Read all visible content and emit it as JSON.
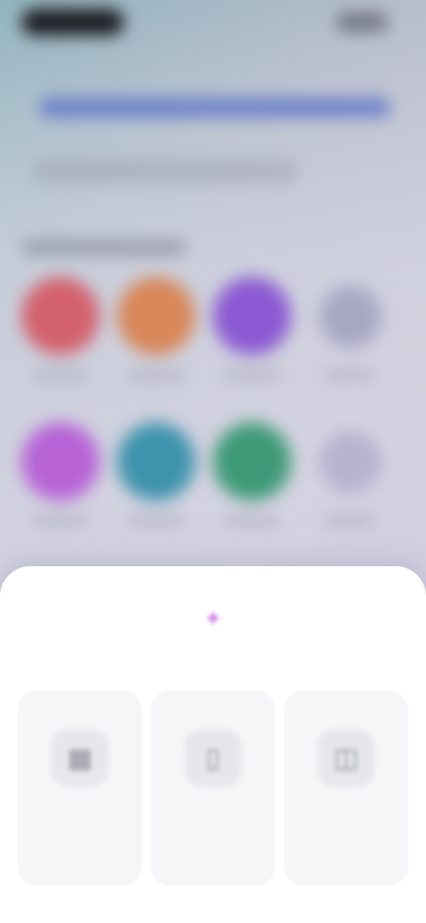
{
  "background": {
    "circles_row1": [
      {
        "color": "#d3616e"
      },
      {
        "color": "#d8875a"
      },
      {
        "color": "#8c5ad2"
      },
      {
        "color": "#a7a7c4"
      }
    ],
    "circles_row2": [
      {
        "color": "#b763d6"
      },
      {
        "color": "#3f93ad"
      },
      {
        "color": "#3f9a78"
      },
      {
        "color": "#b5b3cf"
      }
    ]
  },
  "sheet": {
    "handle_icon": "sparkle-icon",
    "title": "",
    "options": [
      {
        "icon": "grid-icon",
        "label": ""
      },
      {
        "icon": "tablet-icon",
        "label": ""
      },
      {
        "icon": "window-icon",
        "label": ""
      }
    ]
  },
  "colors": {
    "accent": "#d58be8",
    "sheet_bg": "#ffffff"
  }
}
